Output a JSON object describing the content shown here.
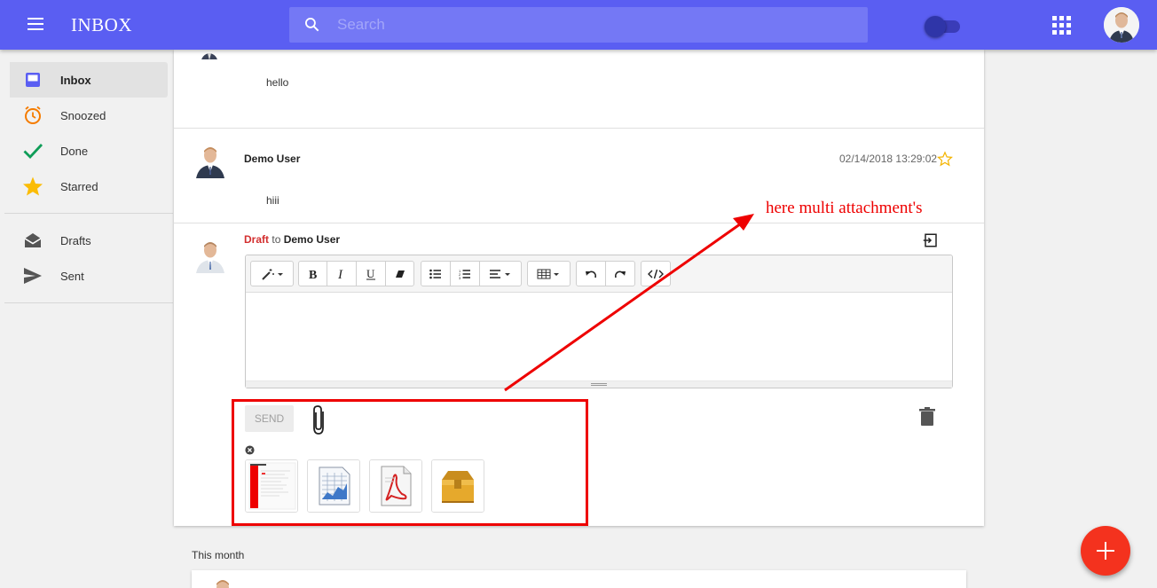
{
  "app": {
    "title": "INBOX"
  },
  "search": {
    "placeholder": "Search",
    "value": ""
  },
  "sidebar": {
    "items": [
      {
        "label": "Inbox",
        "icon": "inbox-icon",
        "active": true
      },
      {
        "label": "Snoozed",
        "icon": "clock-icon",
        "color": "#f57c00"
      },
      {
        "label": "Done",
        "icon": "check-icon",
        "color": "#0f9d58"
      },
      {
        "label": "Starred",
        "icon": "star-icon",
        "color": "#fbbc05"
      },
      {
        "label": "Drafts",
        "icon": "drafts-icon"
      },
      {
        "label": "Sent",
        "icon": "send-icon"
      }
    ]
  },
  "thread": {
    "messages": [
      {
        "body": "hello"
      },
      {
        "sender": "Demo User",
        "date": "02/14/2018 13:29:02",
        "body": "hiii"
      }
    ],
    "draft": {
      "label": "Draft",
      "to_word": "to",
      "recipient": "Demo User",
      "send_label": "SEND",
      "editor_content": ""
    },
    "attachments": [
      {
        "type": "image",
        "icon": "image-file-icon"
      },
      {
        "type": "spreadsheet",
        "icon": "spreadsheet-file-icon"
      },
      {
        "type": "pdf",
        "icon": "pdf-file-icon"
      },
      {
        "type": "archive",
        "icon": "archive-file-icon"
      }
    ]
  },
  "annotation": {
    "text": "here multi attachment's",
    "color": "#e00000"
  },
  "list": {
    "section_label": "This month"
  },
  "colors": {
    "topbar": "#5a5ef2",
    "accent": "#f4321e",
    "draft": "#d32f2f"
  }
}
